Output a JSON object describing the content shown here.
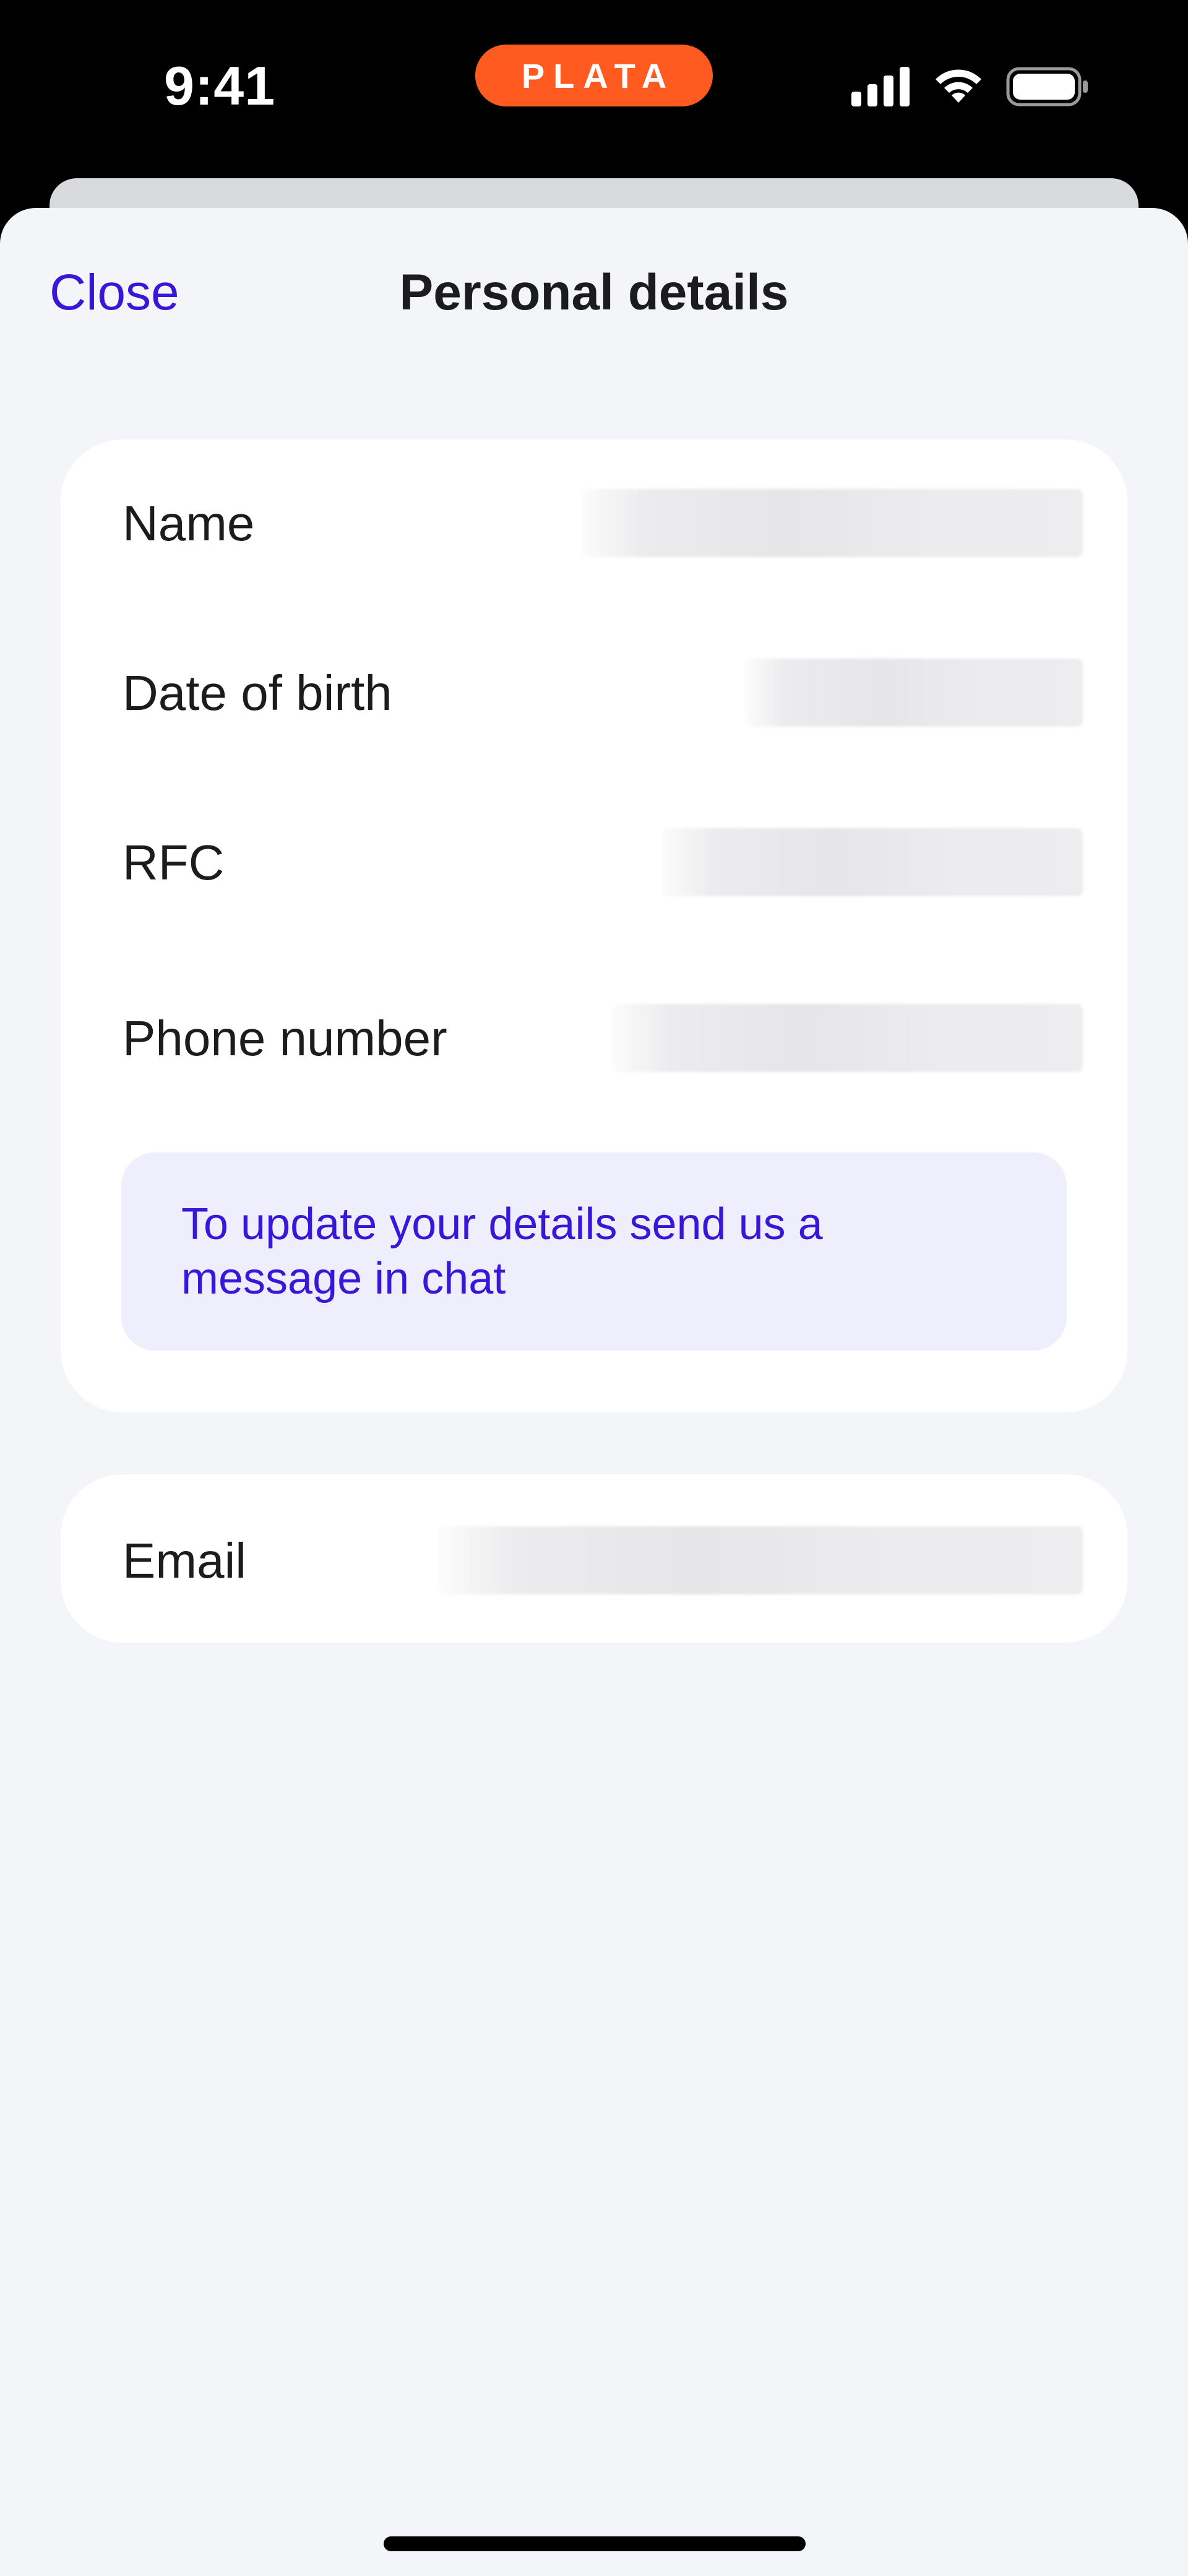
{
  "status_bar": {
    "time": "9:41",
    "brand": "PLATA",
    "icons": [
      "signal-icon",
      "wifi-icon",
      "battery-icon"
    ],
    "brand_color": "#ff5a1f"
  },
  "nav": {
    "close_label": "Close",
    "title": "Personal details"
  },
  "details": {
    "rows": [
      {
        "label": "Name"
      },
      {
        "label": "Date of birth"
      },
      {
        "label": "RFC"
      },
      {
        "label": "Phone number"
      }
    ],
    "info_message": "To update your details send us a message in chat"
  },
  "contact": {
    "email_label": "Email"
  },
  "colors": {
    "accent": "#3a17d8",
    "sheet_background": "#f4f5f9",
    "info_background": "#efeefd"
  }
}
